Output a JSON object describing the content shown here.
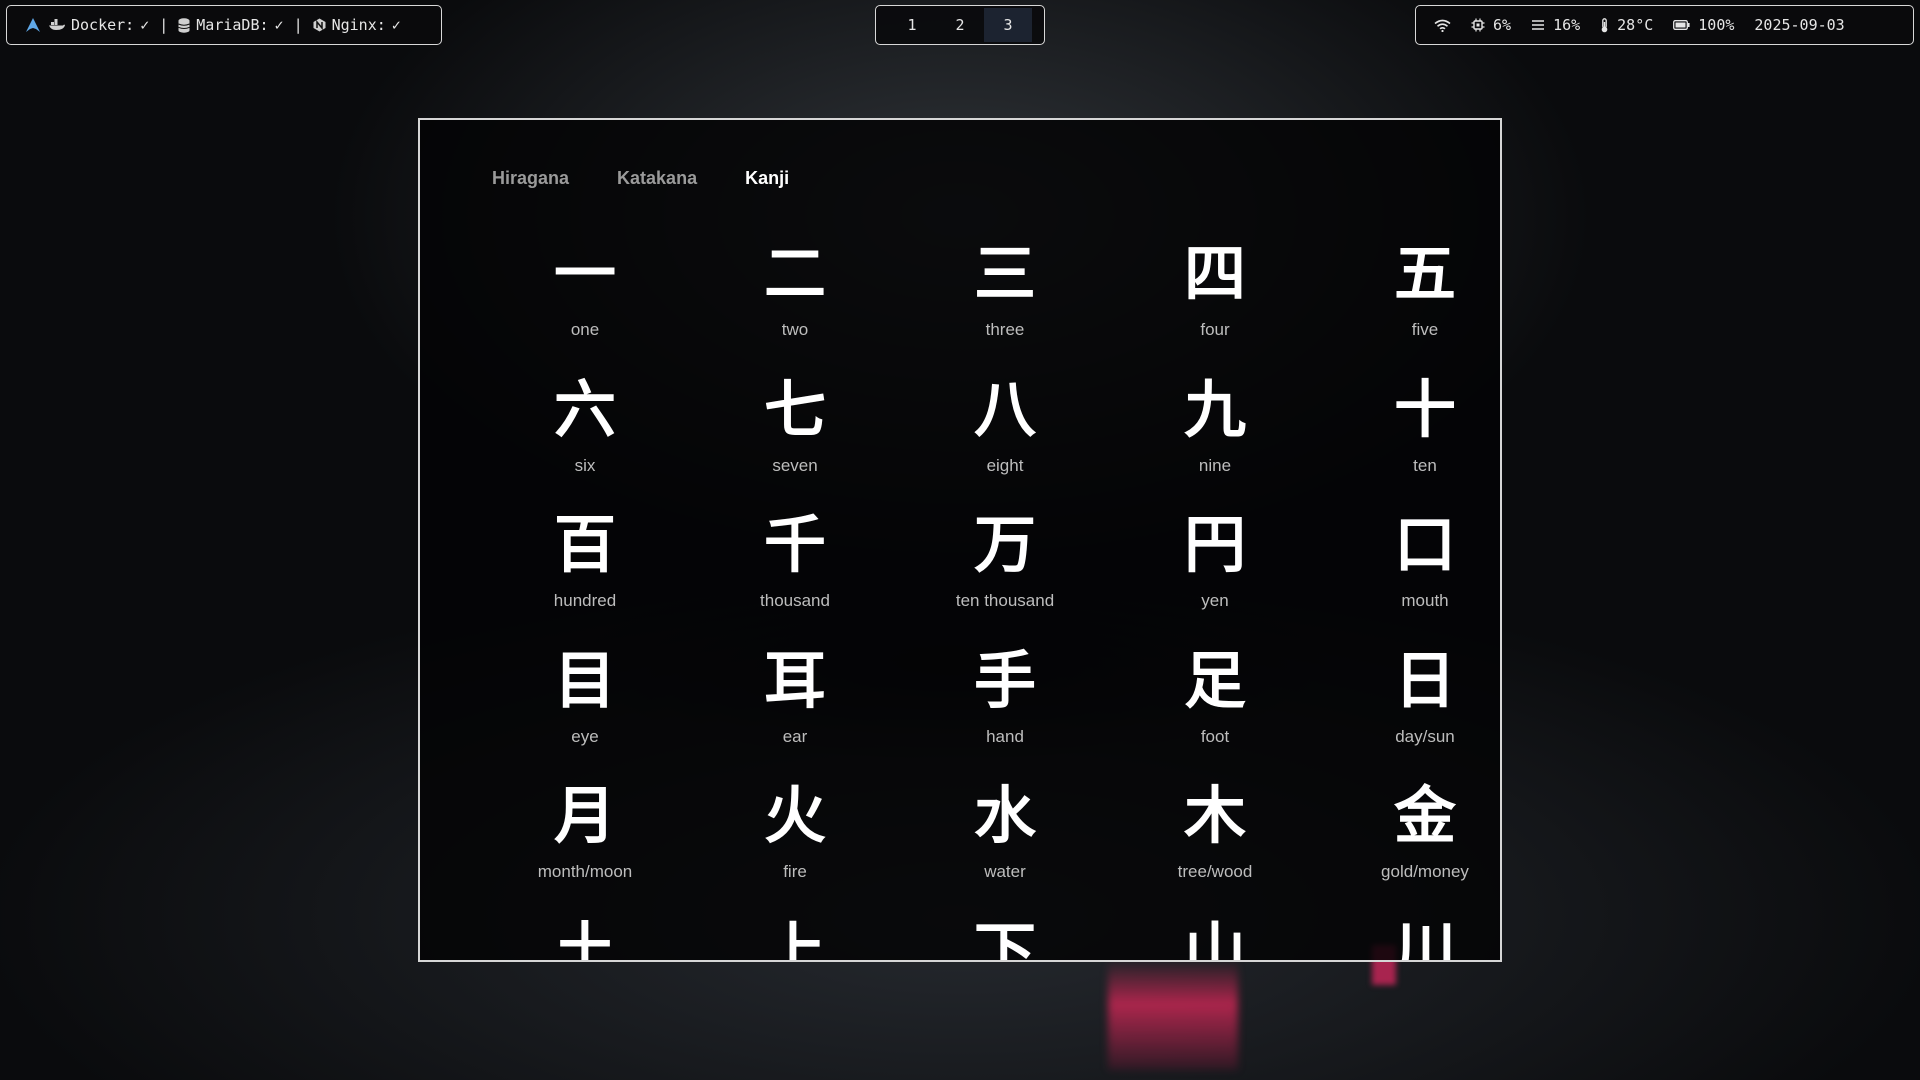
{
  "topbar": {
    "left": {
      "logo_icon": "arch-logo-icon",
      "docker": {
        "icon": "docker-whale-icon",
        "label": "Docker:",
        "status": "✓"
      },
      "mariadb": {
        "icon": "database-icon",
        "label": "MariaDB:",
        "status": "✓"
      },
      "nginx": {
        "icon": "nginx-icon",
        "label": "Nginx:",
        "status": "✓"
      },
      "separator": "|"
    },
    "workspaces": [
      {
        "label": "1",
        "active": false
      },
      {
        "label": "2",
        "active": false
      },
      {
        "label": "3",
        "active": true
      }
    ],
    "right": {
      "wifi_icon": "wifi-icon",
      "cpu": {
        "icon": "cpu-icon",
        "value": "6%"
      },
      "memory": {
        "icon": "memory-icon",
        "value": "16%"
      },
      "temperature": {
        "icon": "thermometer-icon",
        "value": "28°C"
      },
      "battery": {
        "icon": "battery-icon",
        "value": "100%"
      },
      "date": "2025-09-03"
    }
  },
  "tabs": [
    {
      "label": "Hiragana",
      "active": false
    },
    {
      "label": "Katakana",
      "active": false
    },
    {
      "label": "Kanji",
      "active": true
    }
  ],
  "kanji": [
    {
      "glyph": "一",
      "meaning": "one"
    },
    {
      "glyph": "二",
      "meaning": "two"
    },
    {
      "glyph": "三",
      "meaning": "three"
    },
    {
      "glyph": "四",
      "meaning": "four"
    },
    {
      "glyph": "五",
      "meaning": "five"
    },
    {
      "glyph": "六",
      "meaning": "six"
    },
    {
      "glyph": "七",
      "meaning": "seven"
    },
    {
      "glyph": "八",
      "meaning": "eight"
    },
    {
      "glyph": "九",
      "meaning": "nine"
    },
    {
      "glyph": "十",
      "meaning": "ten"
    },
    {
      "glyph": "百",
      "meaning": "hundred"
    },
    {
      "glyph": "千",
      "meaning": "thousand"
    },
    {
      "glyph": "万",
      "meaning": "ten thousand"
    },
    {
      "glyph": "円",
      "meaning": "yen"
    },
    {
      "glyph": "口",
      "meaning": "mouth"
    },
    {
      "glyph": "目",
      "meaning": "eye"
    },
    {
      "glyph": "耳",
      "meaning": "ear"
    },
    {
      "glyph": "手",
      "meaning": "hand"
    },
    {
      "glyph": "足",
      "meaning": "foot"
    },
    {
      "glyph": "日",
      "meaning": "day/sun"
    },
    {
      "glyph": "月",
      "meaning": "month/moon"
    },
    {
      "glyph": "火",
      "meaning": "fire"
    },
    {
      "glyph": "水",
      "meaning": "water"
    },
    {
      "glyph": "木",
      "meaning": "tree/wood"
    },
    {
      "glyph": "金",
      "meaning": "gold/money"
    },
    {
      "glyph": "土",
      "meaning": ""
    },
    {
      "glyph": "上",
      "meaning": ""
    },
    {
      "glyph": "下",
      "meaning": ""
    },
    {
      "glyph": "山",
      "meaning": ""
    },
    {
      "glyph": "川",
      "meaning": ""
    }
  ]
}
